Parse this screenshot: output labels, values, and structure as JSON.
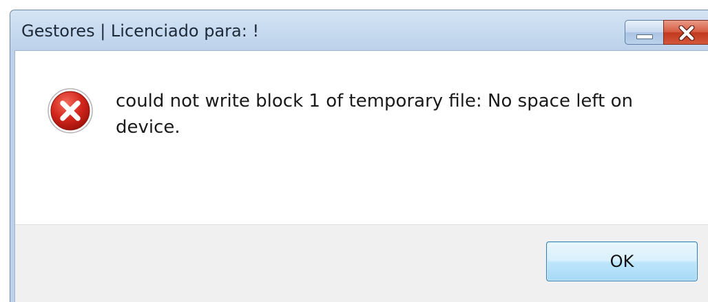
{
  "window": {
    "title": "Gestores | Licenciado para: !"
  },
  "titlebar_buttons": {
    "minimize_icon": "minimize-icon",
    "close_icon": "close-icon"
  },
  "dialog": {
    "icon": "error-icon",
    "message": "could not write block 1 of temporary file: No space left on device."
  },
  "buttons": {
    "ok_label": "OK"
  },
  "colors": {
    "error_red": "#c8281f",
    "close_button_red": "#c0391f",
    "ok_button_border": "#3c7fb1"
  }
}
